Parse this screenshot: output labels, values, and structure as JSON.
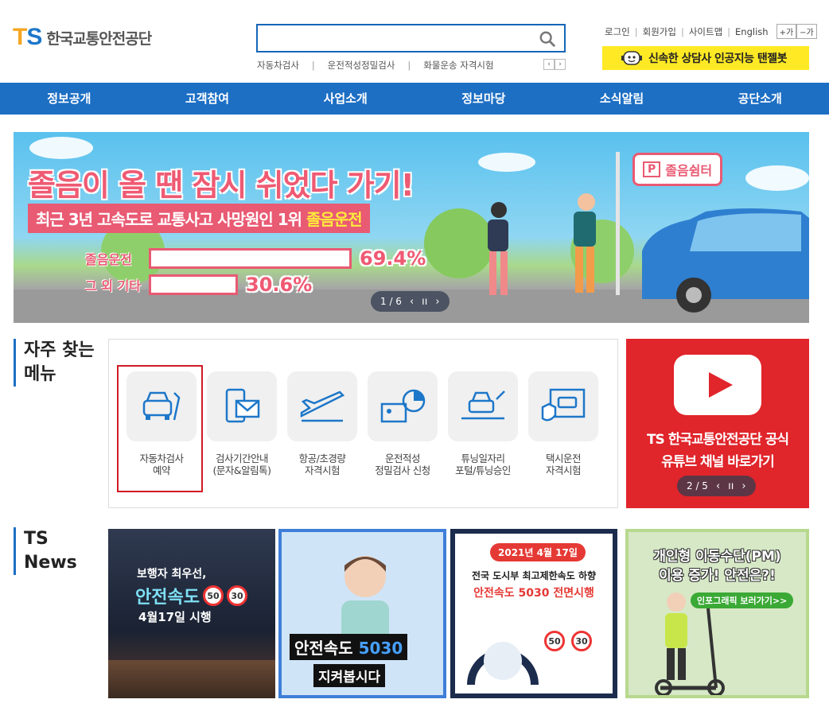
{
  "header": {
    "logo_mark_t": "T",
    "logo_mark_s": "S",
    "logo_text": "한국교통안전공단",
    "search_placeholder": "",
    "quick_links": [
      "자동차검사",
      "운전적성정밀검사",
      "화물운송 자격시험"
    ],
    "util_links": [
      "로그인",
      "회원가입",
      "사이트맵",
      "English"
    ],
    "font_plus": "+가",
    "font_minus": "−가",
    "chatbot_label": "신속한 상담사 인공지능 탠젤봇"
  },
  "nav": [
    "정보공개",
    "고객참여",
    "사업소개",
    "정보마당",
    "소식알림",
    "공단소개"
  ],
  "banner": {
    "title": "졸음이 올 땐 잠시 쉬었다 가기!",
    "sub_prefix": "최근 3년 고속도로 교통사고 사망원인 1위",
    "sub_highlight": "졸음운전",
    "shelter_p": "P",
    "shelter_label": "졸음쉼터",
    "bars": [
      {
        "label": "졸음운전",
        "value": "69.4%",
        "fraction": 0.694
      },
      {
        "label": "그 외 기타",
        "value": "30.6%",
        "fraction": 0.306
      }
    ],
    "pager": "1 / 6"
  },
  "sections": {
    "menu_title_1": "자주 찾는",
    "menu_title_2": "메뉴",
    "news_title_1": "TS",
    "news_title_2": "News"
  },
  "menu_items": [
    {
      "label": "자동차검사\n예약",
      "icon": "car-repair-icon"
    },
    {
      "label": "검사기간안내\n(문자&알림톡)",
      "icon": "phone-mail-icon"
    },
    {
      "label": "항공/초경량\n자격시험",
      "icon": "airplane-icon"
    },
    {
      "label": "운전적성\n정밀검사 신청",
      "icon": "id-chart-icon"
    },
    {
      "label": "튜닝일자리\n포털/튜닝승인",
      "icon": "car-tuning-icon"
    },
    {
      "label": "택시운전\n자격시험",
      "icon": "taxi-license-icon"
    }
  ],
  "youtube": {
    "line1": "TS 한국교통안전공단 공식",
    "line2": "유튜브 채널 바로가기",
    "pager": "2 / 5"
  },
  "news": [
    {
      "line1": "보행자 최우선,",
      "line2": "안전속도",
      "n1": "50",
      "n2": "30",
      "line3": "4월17일 시행"
    },
    {
      "line1": "안전속도",
      "line1b": "5030",
      "line2": "지켜봅시다"
    },
    {
      "date": "2021년 4월 17일",
      "line1": "전국 도시부 최고제한속도 하향",
      "line2": "안전속도 5030 전면시행",
      "s1": "50",
      "s2": "30"
    },
    {
      "line1": "개인형 이동수단(PM)",
      "line2": "이용 증가! 안전은?!",
      "link": "인포그래픽 보러가기>>"
    }
  ],
  "colors": {
    "brand_blue": "#1d6fc4",
    "brand_orange": "#f5a623",
    "banner_pink": "#e95a73",
    "youtube_red": "#e0252b",
    "chatbot_yellow": "#ffe924"
  }
}
